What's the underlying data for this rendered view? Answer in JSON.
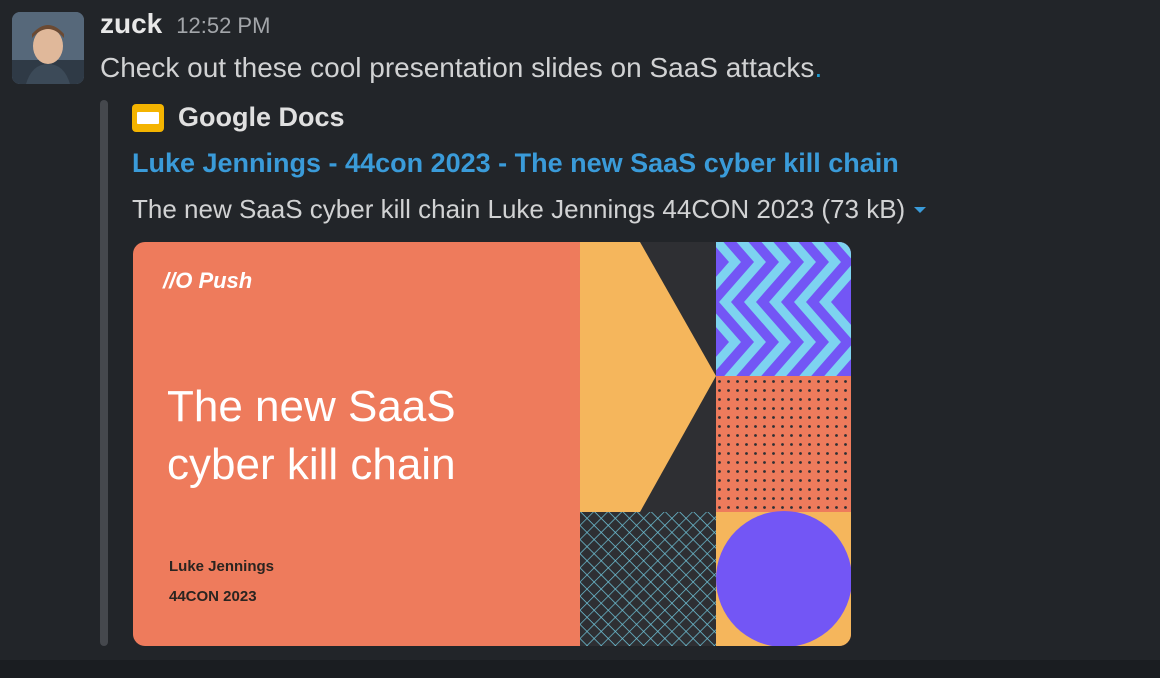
{
  "message": {
    "author": "zuck",
    "time": "12:52 PM",
    "text": "Check out these cool presentation slides on SaaS attacks",
    "text_end": "."
  },
  "attachment": {
    "service_icon": "google-slides-icon",
    "service_name": "Google Docs",
    "title": "Luke Jennings - 44con 2023 - The new SaaS cyber kill chain",
    "meta": "The new SaaS cyber kill chain Luke Jennings 44CON 2023 (73 kB)",
    "expand_icon": "caret-down-icon"
  },
  "slide": {
    "logo": "//O Push",
    "title_line1": "The new SaaS",
    "title_line2": "cyber kill chain",
    "author": "Luke Jennings",
    "conference": "44CON 2023"
  },
  "colors": {
    "background": "#222529",
    "link": "#3a9bd9",
    "slide_orange": "#ee7b5c",
    "slide_yellow": "#f5b65c",
    "slide_purple": "#7356f5",
    "slide_light_blue": "#7dd3f0",
    "slide_dark": "#2e2f33"
  }
}
